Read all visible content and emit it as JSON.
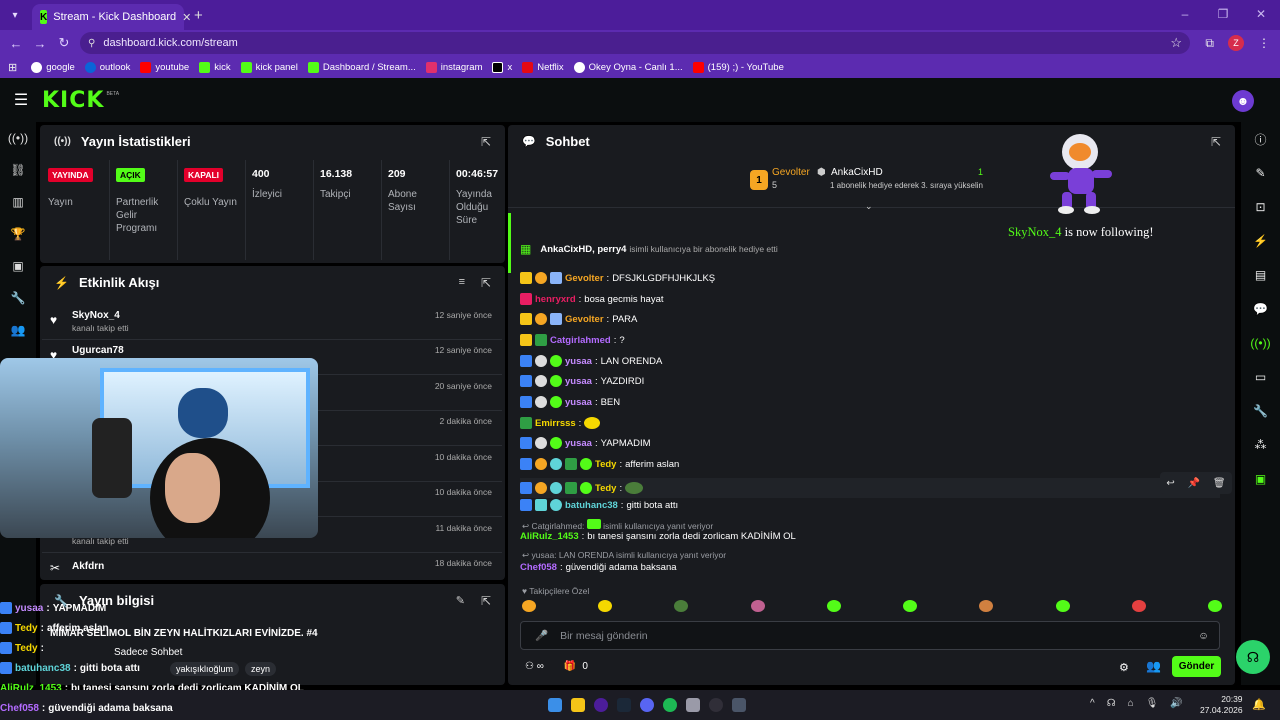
{
  "browser": {
    "tab_title": "Stream - Kick Dashboard",
    "url": "dashboard.kick.com/stream",
    "profile_initial": "Z",
    "bookmarks": [
      {
        "label": "google",
        "color": "#ffffff"
      },
      {
        "label": "outlook",
        "color": "#0a64d8"
      },
      {
        "label": "youtube",
        "color": "#ff0000"
      },
      {
        "label": "kick",
        "color": "#53fc18"
      },
      {
        "label": "kick panel",
        "color": "#53fc18"
      },
      {
        "label": "Dashboard / Stream...",
        "color": "#53fc18"
      },
      {
        "label": "instagram",
        "color": "#e1306c"
      },
      {
        "label": "x",
        "color": "#000000"
      },
      {
        "label": "Netflix",
        "color": "#e50914"
      },
      {
        "label": "Okey Oyna - Canlı 1...",
        "color": "#ffffff"
      },
      {
        "label": "(159) ;) - YouTube",
        "color": "#ff0000"
      }
    ]
  },
  "kick": {
    "logo": "KICK",
    "beta": "BETA"
  },
  "stats_panel": {
    "title": "Yayın İstatistikleri",
    "items": [
      {
        "badge": "YAYINDA",
        "badge_color": "#e3002b",
        "label": "Yayın"
      },
      {
        "badge": "AÇIK",
        "badge_color": "#53fc18",
        "label": "Partnerlik Gelir Programı"
      },
      {
        "badge": "KAPALI",
        "badge_color": "#e3002b",
        "label": "Çoklu Yayın"
      },
      {
        "value": "400",
        "label": "İzleyici"
      },
      {
        "value": "16.138",
        "label": "Takipçi"
      },
      {
        "value": "209",
        "label": "Abone Sayısı"
      },
      {
        "value": "00:46:57",
        "label": "Yayında Olduğu Süre"
      }
    ]
  },
  "activity": {
    "title": "Etkinlik Akışı",
    "items": [
      {
        "name": "SkyNox_4",
        "sub": "kanalı takip etti",
        "time": "12 saniye önce"
      },
      {
        "name": "Ugurcan78",
        "sub": "",
        "time": "12 saniye önce"
      },
      {
        "name": "",
        "sub": "",
        "time": "20 saniye önce"
      },
      {
        "name": "",
        "sub": "",
        "time": "2 dakika önce"
      },
      {
        "name": "",
        "sub": "",
        "time": "10 dakika önce"
      },
      {
        "name": "",
        "sub": "",
        "time": "10 dakika önce"
      },
      {
        "name": "",
        "sub": "kanalı takip etti",
        "time": "11 dakika önce"
      },
      {
        "name": "Akfdrn",
        "sub": "",
        "time": "18 dakika önce"
      }
    ]
  },
  "stream_info": {
    "title": "Yayın bilgisi",
    "stream_title": "MİMAR SELİMOL BİN ZEYN HALİTKIZLARI EVİNİZDE. #4",
    "category": "Sadece Sohbet",
    "tags": [
      "yakışıklıoğlum",
      "zeyn"
    ]
  },
  "chat": {
    "title": "Sohbet",
    "pinned_left_name": "Gevolter",
    "pinned_left_rank": "1",
    "pinned_left_count": "5",
    "pinned_right_name": "AnkaCixHD",
    "pinned_right_count": "1",
    "pinned_right_text": "1 abonelik hediye ederek 3. sıraya yükselin",
    "gift_text_users": "AnkaCixHD, perry4",
    "gift_text": "isimli kullanıcıya bir abonelik hediye etti",
    "messages": [
      {
        "user": "Gevolter",
        "color": "#f5a623",
        "text": "DFSJKLGDFHJHKJLKŞ"
      },
      {
        "user": "henryxrd",
        "color": "#e91e63",
        "text": "bosa gecmis hayat"
      },
      {
        "user": "Gevolter",
        "color": "#f5a623",
        "text": "PARA"
      },
      {
        "user": "Catgirlahmed",
        "color": "#b36bff",
        "text": "?"
      },
      {
        "user": "yusaa",
        "color": "#c58bff",
        "text": "LAN ORENDA"
      },
      {
        "user": "yusaa",
        "color": "#c58bff",
        "text": "YAZDIRDI"
      },
      {
        "user": "yusaa",
        "color": "#c58bff",
        "text": "BEN"
      },
      {
        "user": "Emirrsss",
        "color": "#f5d800",
        "text": ""
      },
      {
        "user": "yusaa",
        "color": "#c58bff",
        "text": "YAPMADIM"
      },
      {
        "user": "Tedy",
        "color": "#f5d800",
        "text": "afferim aslan"
      },
      {
        "user": "Tedy",
        "color": "#f5d800",
        "text": ""
      },
      {
        "user": "batuhanc38",
        "color": "#5fd4d8",
        "text": "gitti bota attı"
      }
    ],
    "reply1_hint_user": "Catgirlahmed:",
    "reply1_hint_text": "isimli kullanıcıya yanıt veriyor",
    "reply1_user": "AliRulz_1453",
    "reply1_text": "bı tanesi şansını zorla dedi zorlicam KADİNİM OL",
    "reply2_hint": "yusaa: LAN ORENDA isimli kullanıcıya yanıt veriyor",
    "reply2_user": "Chef058",
    "reply2_text": "güvendiği adama baksana",
    "followers_only": "Takipçilere Özel",
    "input_placeholder": "Bir mesaj gönderin",
    "points": "0",
    "send_label": "Gönder"
  },
  "overlay": {
    "follow_user": "SkyNox_4",
    "follow_text": "is now following!",
    "lines": [
      {
        "user": "yusaa",
        "color": "#c58bff",
        "text": "YAPMADIM"
      },
      {
        "user": "Tedy",
        "color": "#f5d800",
        "text": "afferim aslan"
      },
      {
        "user": "Tedy",
        "color": "#f5d800",
        "text": ""
      },
      {
        "user": "batuhanc38",
        "color": "#5fd4d8",
        "text": "gitti bota attı"
      },
      {
        "user": "AliRulz_1453",
        "color": "#53fc18",
        "text": "bı tanesi şansını zorla dedi zorlicam KADİNİM OL"
      },
      {
        "user": "Chef058",
        "color": "#b36bff",
        "text": "güvendiği adama baksana"
      }
    ]
  },
  "taskbar": {
    "time": "20:39",
    "date": "27.04.2026"
  }
}
